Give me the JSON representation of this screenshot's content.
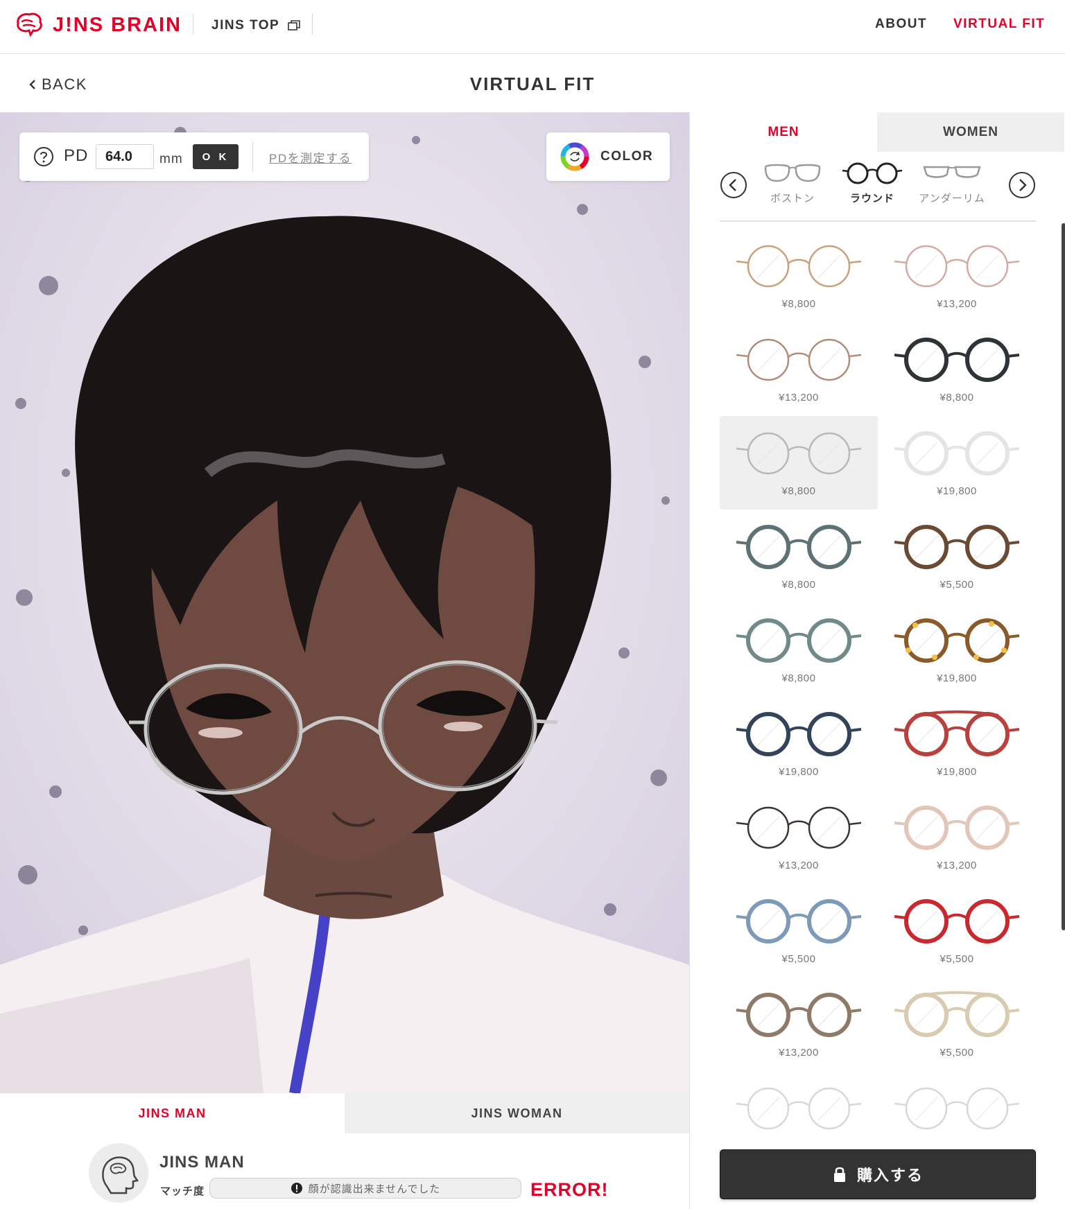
{
  "header": {
    "brand": "J!NS BRAIN",
    "jins_top": "JINS TOP",
    "nav": [
      "ABOUT",
      "VIRTUAL FIT"
    ]
  },
  "subheader": {
    "back": "BACK",
    "title": "VIRTUAL FIT"
  },
  "pd": {
    "label": "PD",
    "value": "64.0",
    "unit": "mm",
    "ok": "O K",
    "measure": "PDを測定する"
  },
  "color_button": {
    "label": "COLOR"
  },
  "model_tabs": [
    "JINS MAN",
    "JINS WOMAN"
  ],
  "result": {
    "name": "JINS MAN",
    "match_label": "マッチ度",
    "message": "顔が認識出来ませんでした",
    "error": "ERROR!"
  },
  "gender_tabs": [
    "MEN",
    "WOMEN"
  ],
  "shapes": [
    "ボストン",
    "ラウンド",
    "アンダーリム"
  ],
  "active_shape": "ラウンド",
  "products": [
    {
      "price": "¥8,800",
      "color": "#c9a07a",
      "style": "thin"
    },
    {
      "price": "¥13,200",
      "color": "#d6aaa0",
      "style": "thin"
    },
    {
      "price": "¥13,200",
      "color": "#b08c7a",
      "style": "thin"
    },
    {
      "price": "¥8,800",
      "color": "#2e3336",
      "style": "thick"
    },
    {
      "price": "¥8,800",
      "color": "#b8b8b8",
      "style": "thin"
    },
    {
      "price": "¥19,800",
      "color": "#e4e4e4",
      "style": "thick"
    },
    {
      "price": "¥8,800",
      "color": "#5e7276",
      "style": "thick"
    },
    {
      "price": "¥5,500",
      "color": "#6b4a34",
      "style": "thick"
    },
    {
      "price": "¥8,800",
      "color": "#6f8a88",
      "style": "thick"
    },
    {
      "price": "¥19,800",
      "color": "#8a5a28",
      "style": "tortoise"
    },
    {
      "price": "¥19,800",
      "color": "#33445a",
      "style": "thick"
    },
    {
      "price": "¥19,800",
      "color": "#b8413e",
      "style": "bar"
    },
    {
      "price": "¥13,200",
      "color": "#3a3530",
      "style": "thin"
    },
    {
      "price": "¥13,200",
      "color": "#e2c6b8",
      "style": "thick"
    },
    {
      "price": "¥5,500",
      "color": "#7d9ab8",
      "style": "thick"
    },
    {
      "price": "¥5,500",
      "color": "#c8282e",
      "style": "thick"
    },
    {
      "price": "¥13,200",
      "color": "#8e7a68",
      "style": "thick"
    },
    {
      "price": "¥5,500",
      "color": "#d8cbb0",
      "style": "bar"
    },
    {
      "price": "",
      "color": "#d8d8d8",
      "style": "thin"
    },
    {
      "price": "",
      "color": "#d8d8d8",
      "style": "thin"
    }
  ],
  "selected_index": 4,
  "buy": {
    "label": "購入する"
  },
  "colors": {
    "accent": "#e60028",
    "dark": "#333333",
    "tab_inactive": "#efefef"
  }
}
